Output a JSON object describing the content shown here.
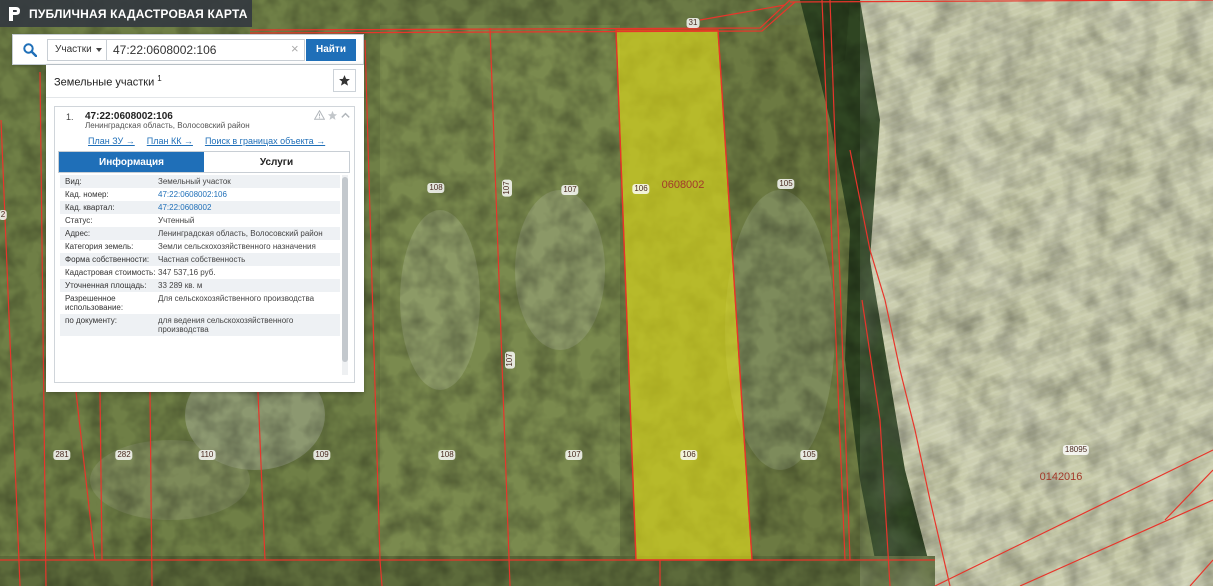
{
  "app": {
    "title": "ПУБЛИЧНАЯ КАДАСТРОВАЯ КАРТА"
  },
  "search": {
    "type_label": "Участки",
    "query": "47:22:0608002:106",
    "clear_symbol": "×",
    "button_label": "Найти"
  },
  "panel": {
    "title": "Земельные участки",
    "title_sup": "1",
    "item": {
      "index": "1.",
      "cad_number": "47:22:0608002:106",
      "address": "Ленинградская область, Волосовский район"
    },
    "links": [
      "План ЗУ →",
      "План КК →",
      "Поиск в границах объекта →"
    ],
    "tabs": [
      "Информация",
      "Услуги"
    ],
    "rows": [
      {
        "k": "Вид:",
        "v": "Земельный участок"
      },
      {
        "k": "Кад. номер:",
        "v": "47:22:0608002:106"
      },
      {
        "k": "Кад. квартал:",
        "v": "47:22:0608002"
      },
      {
        "k": "Статус:",
        "v": "Учтенный"
      },
      {
        "k": "Адрес:",
        "v": "Ленинградская область, Волосовский район"
      },
      {
        "k": "Категория земель:",
        "v": "Земли сельскохозяйственного назначения"
      },
      {
        "k": "Форма собственности:",
        "v": "Частная собственность"
      },
      {
        "k": "Кадастровая стоимость:",
        "v": "347 537,16 руб."
      },
      {
        "k": "Уточненная площадь:",
        "v": "33 289 кв. м"
      },
      {
        "k": "Разрешенное использование:",
        "v": "Для сельскохозяйственного производства"
      },
      {
        "k": "по документу:",
        "v": "для ведения сельскохозяйственного производства"
      }
    ]
  },
  "map": {
    "plot_labels": [
      "108",
      "107",
      "107",
      "106",
      "105",
      "107",
      "281",
      "282",
      "110",
      "109",
      "108",
      "107",
      "106",
      "105",
      "31",
      "2",
      "18095"
    ],
    "quarter_labels": [
      "0608002",
      "0142016"
    ],
    "colors": {
      "boundary": "#e8352b",
      "highlight": "#e6e21a",
      "accent": "#1f6fb8"
    }
  }
}
